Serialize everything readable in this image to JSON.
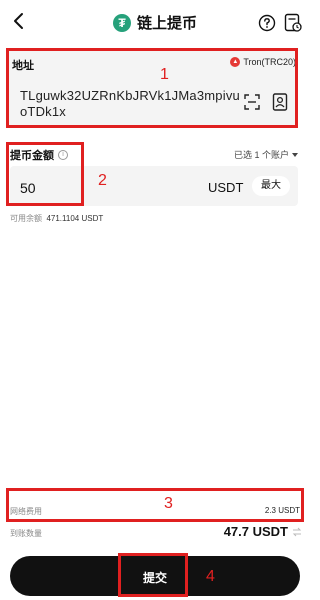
{
  "header": {
    "title": "链上提币",
    "token_glyph": "₮"
  },
  "address": {
    "label": "地址",
    "network": "Tron(TRC20)",
    "value": "TLguwk32UZRnKbJRVk1JMa3mpivuoTDk1x"
  },
  "amount": {
    "label": "提币金额",
    "account_selector": "已选 1 个账户",
    "value": "50",
    "currency": "USDT",
    "max_label": "最大",
    "available_label": "可用余额",
    "available_value": "471.1104 USDT"
  },
  "fee": {
    "label": "网络费用",
    "value": "2.3 USDT"
  },
  "receive": {
    "label": "到账数量",
    "value": "47.7 USDT"
  },
  "submit_label": "提交",
  "annotations": [
    "1",
    "2",
    "3",
    "4"
  ],
  "colors": {
    "annotation": "#e02020",
    "tether": "#26a17b",
    "tron": "#e53935",
    "button": "#111111"
  }
}
